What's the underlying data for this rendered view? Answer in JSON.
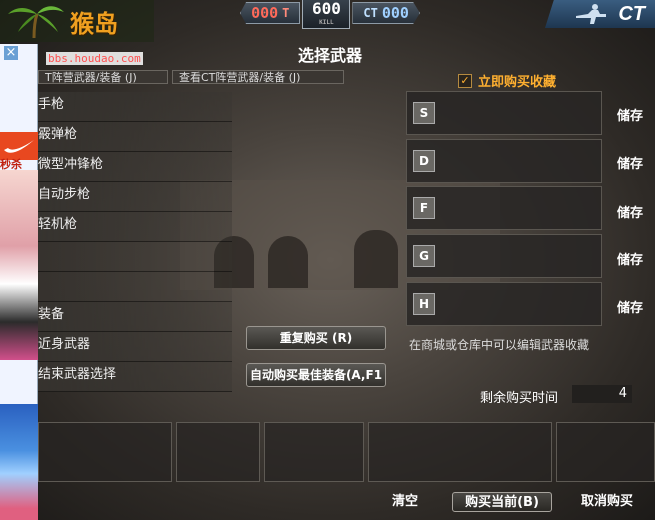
{
  "hud": {
    "t_score": "000",
    "t_tag": "T",
    "round_timer": "600",
    "timer_caption": "KILL",
    "ct_score": "000",
    "ct_tag": "CT",
    "team_label": "CT"
  },
  "watermark": {
    "site_name": "猴岛",
    "url": "bbs.houdao.com"
  },
  "ad": {
    "close": "×",
    "text": "秒杀"
  },
  "title": "选择武器",
  "tabs": [
    {
      "label": "T阵营武器/装备 (J)"
    },
    {
      "label": "查看CT阵营武器/装备 (J)"
    }
  ],
  "instant_buy_favorites": {
    "label": "立即购买收藏",
    "checked": true,
    "check": "✓"
  },
  "categories": [
    {
      "label": "手枪"
    },
    {
      "label": "霰弹枪"
    },
    {
      "label": "微型冲锋枪"
    },
    {
      "label": "自动步枪"
    },
    {
      "label": "轻机枪"
    },
    {
      "label": ""
    },
    {
      "label": ""
    },
    {
      "label": "装备"
    },
    {
      "label": "近身武器"
    },
    {
      "label": "结束武器选择"
    }
  ],
  "favorite_slots": [
    {
      "key": "S",
      "store": "储存"
    },
    {
      "key": "D",
      "store": "储存"
    },
    {
      "key": "F",
      "store": "储存"
    },
    {
      "key": "G",
      "store": "储存"
    },
    {
      "key": "H",
      "store": "储存"
    }
  ],
  "edit_hint": "在商城或仓库中可以编辑武器收藏",
  "remaining_time": {
    "label": "剩余购买时间",
    "value": "4"
  },
  "buttons": {
    "rebuy": "重复购买 (R)",
    "auto_buy": "自动购买最佳装备(A,F1",
    "clear": "清空",
    "buy_current": "购买当前(B)",
    "cancel_buy": "取消购买"
  }
}
